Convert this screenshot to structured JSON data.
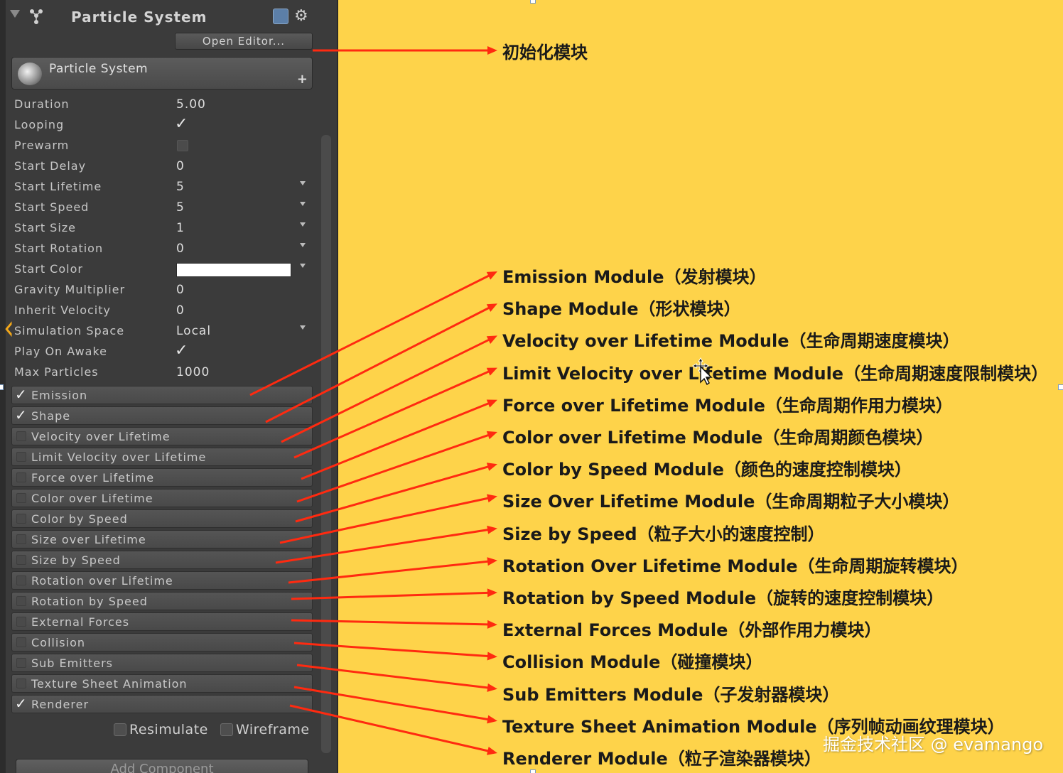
{
  "inspector": {
    "title": "Particle System",
    "open_editor": "Open Editor...",
    "component_name": "Particle System",
    "properties": [
      {
        "label": "Duration",
        "value": "5.00",
        "kind": "text"
      },
      {
        "label": "Looping",
        "value": "",
        "kind": "check"
      },
      {
        "label": "Prewarm",
        "value": "",
        "kind": "box"
      },
      {
        "label": "Start Delay",
        "value": "0",
        "kind": "text"
      },
      {
        "label": "Start Lifetime",
        "value": "5",
        "kind": "text",
        "caret": true
      },
      {
        "label": "Start Speed",
        "value": "5",
        "kind": "text",
        "caret": true
      },
      {
        "label": "Start Size",
        "value": "1",
        "kind": "text",
        "caret": true
      },
      {
        "label": "Start Rotation",
        "value": "0",
        "kind": "text",
        "caret": true
      },
      {
        "label": "Start Color",
        "value": "",
        "kind": "color",
        "caret": true
      },
      {
        "label": "Gravity Multiplier",
        "value": "0",
        "kind": "text"
      },
      {
        "label": "Inherit Velocity",
        "value": "0",
        "kind": "text"
      },
      {
        "label": "Simulation Space",
        "value": "Local",
        "kind": "text",
        "caret": true
      },
      {
        "label": "Play On Awake",
        "value": "",
        "kind": "check"
      },
      {
        "label": "Max Particles",
        "value": "1000",
        "kind": "text"
      }
    ],
    "modules": [
      {
        "label": "Emission",
        "checked": true
      },
      {
        "label": "Shape",
        "checked": true
      },
      {
        "label": "Velocity over Lifetime",
        "checked": false
      },
      {
        "label": "Limit Velocity over Lifetime",
        "checked": false
      },
      {
        "label": "Force over Lifetime",
        "checked": false
      },
      {
        "label": "Color over Lifetime",
        "checked": false
      },
      {
        "label": "Color by Speed",
        "checked": false
      },
      {
        "label": "Size over Lifetime",
        "checked": false
      },
      {
        "label": "Size by Speed",
        "checked": false
      },
      {
        "label": "Rotation over Lifetime",
        "checked": false
      },
      {
        "label": "Rotation by Speed",
        "checked": false
      },
      {
        "label": "External Forces",
        "checked": false
      },
      {
        "label": "Collision",
        "checked": false
      },
      {
        "label": "Sub Emitters",
        "checked": false
      },
      {
        "label": "Texture Sheet Animation",
        "checked": false
      },
      {
        "label": "Renderer",
        "checked": true
      }
    ],
    "resimulate": "Resimulate",
    "wireframe": "Wireframe",
    "add_component": "Add Component"
  },
  "annotations": {
    "init": "初始化模块",
    "modules": [
      "Emission Module（发射模块）",
      "Shape Module（形状模块）",
      "Velocity over Lifetime Module（生命周期速度模块）",
      "Limit Velocity over Lifetime Module（生命周期速度限制模块）",
      "Force over Lifetime Module（生命周期作用力模块）",
      "Color over Lifetime Module（生命周期颜色模块）",
      "Color by Speed Module（颜色的速度控制模块）",
      "Size Over Lifetime Module（生命周期粒子大小模块）",
      "Size by Speed（粒子大小的速度控制）",
      "Rotation Over Lifetime Module（生命周期旋转模块）",
      "Rotation by Speed Module（旋转的速度控制模块）",
      "External Forces Module（外部作用力模块）",
      "Collision Module（碰撞模块）",
      "Sub Emitters Module（子发射器模块）",
      "Texture Sheet Animation Module（序列帧动画纹理模块）",
      "Renderer Module（粒子渲染器模块）"
    ]
  },
  "watermark": "掘金技术社区 @ evamango",
  "colors": {
    "background": "#fed34a",
    "panel": "#3b3b3b",
    "arrow": "#ff2a10"
  },
  "icons": {
    "fold": "triangle-down-icon",
    "component": "particle-system-icon",
    "help": "help-book-icon",
    "settings": "gear-icon",
    "add": "plus-icon",
    "checkbox": "checkmark-icon",
    "cursor": "move-cursor-icon"
  }
}
